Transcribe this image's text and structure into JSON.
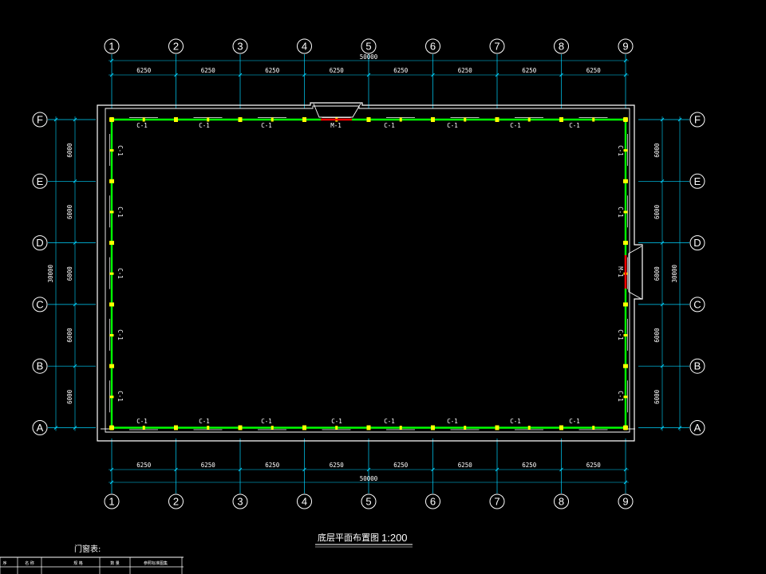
{
  "grid": {
    "columns": [
      "1",
      "2",
      "3",
      "4",
      "5",
      "6",
      "7",
      "8",
      "9"
    ],
    "rows": [
      "F",
      "E",
      "D",
      "C",
      "B",
      "A"
    ],
    "column_spacing": [
      "6250",
      "6250",
      "6250",
      "6250",
      "6250",
      "6250",
      "6250",
      "6250"
    ],
    "row_spacing_left": [
      "6000",
      "6000",
      "6000",
      "6000",
      "6000"
    ],
    "row_spacing_right": [
      "6000",
      "6000",
      "6000",
      "6000",
      "6000"
    ],
    "overall_width": "50000",
    "overall_depth": "30000"
  },
  "windows": {
    "top": [
      "C-1",
      "C-1",
      "C-1",
      "C-1",
      "C-1",
      "C-1",
      "C-1"
    ],
    "bottom": [
      "C-1",
      "C-1",
      "C-1",
      "C-1",
      "C-1",
      "C-1",
      "C-1",
      "C-1"
    ],
    "left": [
      "C-1",
      "C-1",
      "C-1",
      "C-1",
      "C-1"
    ],
    "right": [
      "C-1",
      "C-1",
      "C-1",
      "C-1"
    ]
  },
  "doors": {
    "top": "M-1",
    "right": "M-1"
  },
  "title": {
    "name": "底层平面布置图",
    "scale": "1:200"
  },
  "door_table": {
    "title": "门窗表:",
    "headers": [
      "序",
      "名 称",
      "规 格",
      "数 量",
      "参照标准图集"
    ]
  },
  "colors": {
    "grid": "#00d4ff",
    "wall": "#ffffff",
    "window": "#00ff00",
    "column": "#ffff00",
    "door": "#ff0000"
  }
}
